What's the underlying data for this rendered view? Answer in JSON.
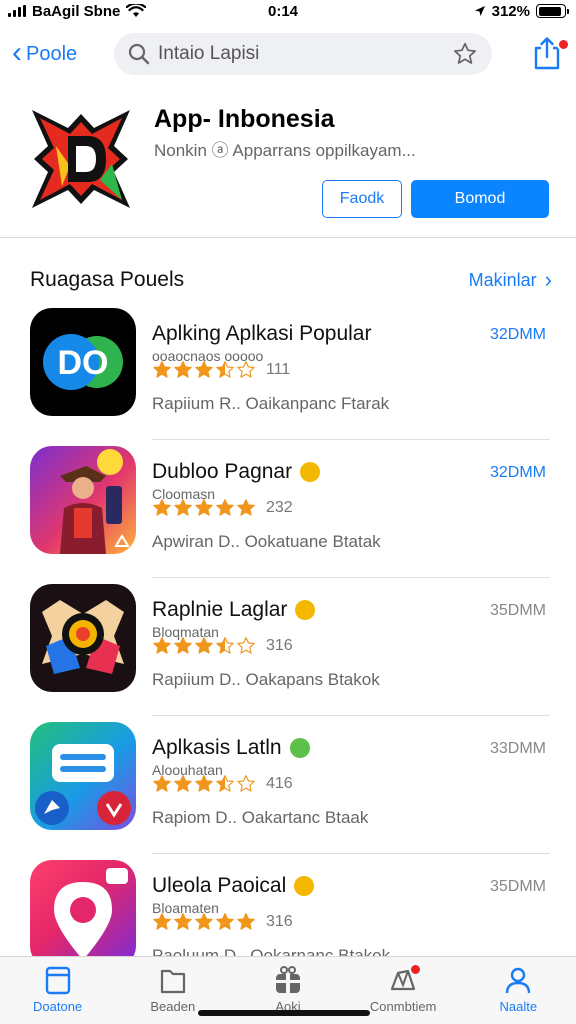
{
  "status_bar": {
    "carrier": "BaAgil Sbne",
    "time": "0:14",
    "battery": "312%",
    "battery_level": 0.9
  },
  "nav": {
    "back_label": "Poole",
    "search_placeholder": "Intaio Lapisi"
  },
  "app": {
    "title": "App- Inbonesia",
    "subtitle": "Nonkin ⓐ Apparrans oppilkayam...",
    "secondary_button": "Faodk",
    "primary_button": "Bomod",
    "brand_colors": {
      "red": "#e52b1f",
      "yellow": "#f7c21a",
      "green": "#2eb84b"
    }
  },
  "section": {
    "title": "Ruagasa Pouels",
    "link": "Makinlar"
  },
  "apps": [
    {
      "name": "Aplking Aplkasi Popular",
      "sub": "ooaocnaos ooooo",
      "rating": 3.5,
      "rating_count": "111",
      "meta": "Rapiium R..  Oaikanpanc  Ftarak",
      "size": "32DMM",
      "size_style": "blue",
      "badge_color": "",
      "icon": "do-app-icon"
    },
    {
      "name": "Dubloo Pagnar",
      "sub": "Cloomasn",
      "rating": 5,
      "rating_count": "232",
      "meta": "Apwiran D..  Ookatuane  Btatak",
      "size": "32DMM",
      "size_style": "blue",
      "badge_color": "#f5b800",
      "icon": "game-character-icon"
    },
    {
      "name": "Raplnie Laglar",
      "sub": "Bloqmatan",
      "rating": 3.5,
      "rating_count": "316",
      "meta": "Rapiium D..  Oakapans  Btakok",
      "size": "35DMM",
      "size_style": "gray",
      "badge_color": "#f5b800",
      "icon": "emblem-icon"
    },
    {
      "name": "Aplkasis Latln",
      "sub": "Aloouhatan",
      "rating": 3.5,
      "rating_count": "416",
      "meta": "Rapiom D..  Oakartanc  Btaak",
      "size": "33DMM",
      "size_style": "gray",
      "badge_color": "#5cc04a",
      "icon": "messages-icon"
    },
    {
      "name": "Uleola Paoical",
      "sub": "Bloamaten",
      "rating": 5,
      "rating_count": "316",
      "meta": "Paoluum D..  Ookarnanc  Btakok",
      "size": "35DMM",
      "size_style": "gray",
      "badge_color": "#f5b800",
      "icon": "location-pin-icon"
    }
  ],
  "tabs": [
    {
      "label": "Doatone",
      "icon": "document-icon",
      "active": true
    },
    {
      "label": "Beaden",
      "icon": "folder-icon",
      "active": false
    },
    {
      "label": "Aoki",
      "icon": "gift-icon",
      "active": false
    },
    {
      "label": "Conmbtiem",
      "icon": "notification-icon",
      "active": false
    },
    {
      "label": "Naalte",
      "icon": "person-icon",
      "active": true
    }
  ]
}
